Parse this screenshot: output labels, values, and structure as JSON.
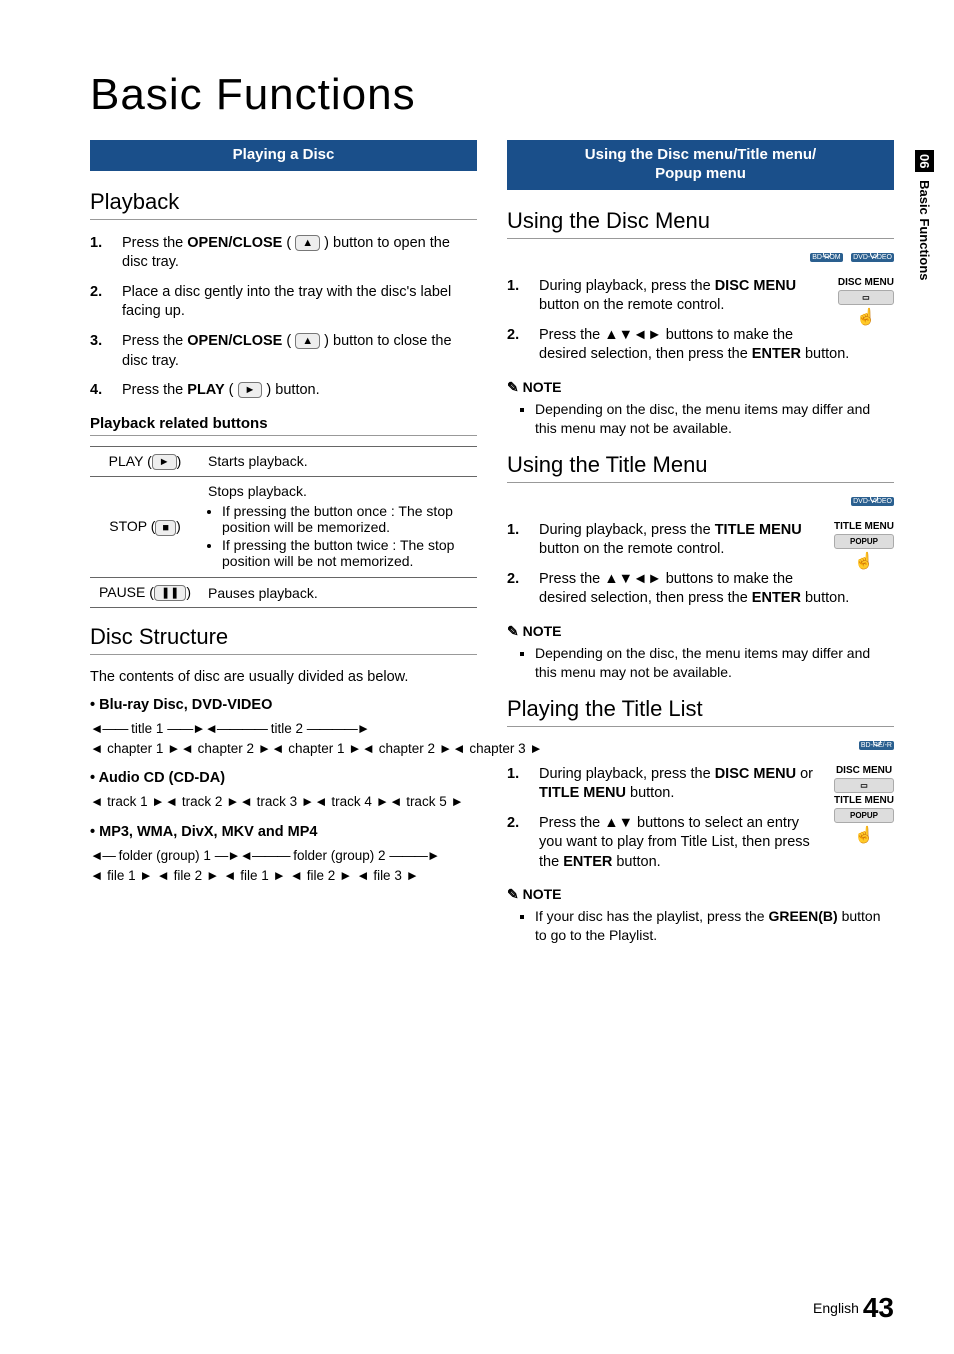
{
  "side_tab": {
    "num": "06",
    "label": "Basic Functions"
  },
  "page_title": "Basic Functions",
  "footer": {
    "lang": "English",
    "page": "43"
  },
  "left": {
    "band": "Playing a Disc",
    "playback": {
      "heading": "Playback",
      "steps": [
        {
          "pre": "Press the ",
          "bold": "OPEN/CLOSE",
          "post": " ( ",
          "icon": "▲",
          "tail": " ) button to open the disc tray."
        },
        {
          "pre": "Place a disc gently into the tray with the disc's label facing up.",
          "bold": "",
          "post": "",
          "icon": "",
          "tail": ""
        },
        {
          "pre": "Press the ",
          "bold": "OPEN/CLOSE",
          "post": " ( ",
          "icon": "▲",
          "tail": " ) button to close the disc tray."
        },
        {
          "pre": "Press the ",
          "bold": "PLAY",
          "post": " ( ",
          "icon": "►",
          "tail": " ) button."
        }
      ],
      "related_head": "Playback related buttons",
      "table": [
        {
          "btn": "PLAY",
          "icon": "►",
          "desc": "Starts playback."
        },
        {
          "btn": "STOP",
          "icon": "■",
          "desc_intro": "Stops playback.",
          "bullets": [
            "If pressing the button once : The stop position will be memorized.",
            "If pressing the button twice : The stop position will be not memorized."
          ]
        },
        {
          "btn": "PAUSE",
          "icon": "❚❚",
          "desc": "Pauses playback."
        }
      ]
    },
    "disc_structure": {
      "heading": "Disc Structure",
      "intro": "The contents of disc are usually divided as below.",
      "groups": [
        {
          "title": "Blu-ray Disc, DVD-VIDEO",
          "line1": [
            "title 1",
            "title 2"
          ],
          "line2": [
            "chapter 1",
            "chapter 2",
            "chapter 1",
            "chapter 2",
            "chapter 3"
          ]
        },
        {
          "title": "Audio CD (CD-DA)",
          "line2": [
            "track 1",
            "track 2",
            "track 3",
            "track 4",
            "track 5"
          ]
        },
        {
          "title": "MP3, WMA, DivX, MKV and MP4",
          "line1": [
            "folder (group) 1",
            "folder (group) 2"
          ],
          "line2": [
            "file 1",
            "file 2",
            "file 1",
            "file 2",
            "file 3"
          ]
        }
      ]
    }
  },
  "right": {
    "band": "Using the Disc menu/Title menu/\nPopup menu",
    "disc_menu": {
      "heading": "Using the Disc Menu",
      "badges": [
        "BD-ROM",
        "DVD-VIDEO"
      ],
      "remote": {
        "label": "DISC MENU"
      },
      "steps": [
        {
          "pre": "During playback, press the ",
          "bold": "DISC MENU",
          "post": " button on the remote control."
        },
        {
          "pre": "Press the ",
          "arrows": "▲▼◄►",
          "mid": " buttons to make the desired selection, then press the ",
          "bold": "ENTER",
          "post": " button."
        }
      ],
      "note_label": "NOTE",
      "notes": [
        "Depending on the disc, the menu items may differ and this menu may not be available."
      ]
    },
    "title_menu": {
      "heading": "Using the Title Menu",
      "badges": [
        "DVD-VIDEO"
      ],
      "remote": {
        "label1": "TITLE MENU",
        "label2": "POPUP"
      },
      "steps": [
        {
          "pre": "During playback, press the ",
          "bold": "TITLE MENU",
          "post": " button on the remote control."
        },
        {
          "pre": "Press the ",
          "arrows": "▲▼◄►",
          "mid": " buttons to make the desired selection, then press the ",
          "bold": "ENTER",
          "post": " button."
        }
      ],
      "note_label": "NOTE",
      "notes": [
        "Depending on the disc, the menu items may differ and this menu may not be available."
      ]
    },
    "title_list": {
      "heading": "Playing the Title List",
      "badges": [
        "BD-RE/-R"
      ],
      "remote": {
        "label1": "DISC MENU",
        "label2": "TITLE MENU",
        "label3": "POPUP"
      },
      "steps": [
        {
          "pre": "During playback, press the ",
          "bold": "DISC MENU",
          "mid": " or ",
          "bold2": "TITLE MENU",
          "post": " button."
        },
        {
          "pre": "Press the ",
          "arrows": "▲▼",
          "mid": " buttons to select an entry you want to play from Title List, then press the ",
          "bold": "ENTER",
          "post": " button."
        }
      ],
      "note_label": "NOTE",
      "notes_rich": {
        "pre": "If your disc has the playlist, press the ",
        "bold": "GREEN(B)",
        "post": " button to go to the Playlist."
      }
    }
  }
}
